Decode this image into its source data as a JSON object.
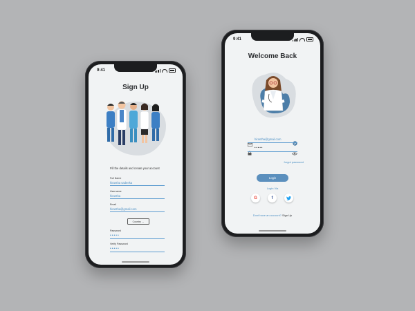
{
  "signup": {
    "time": "9:41",
    "title": "Sign Up",
    "subtitle": "Fill the details and create your account",
    "full_name_label": "Full Name",
    "full_name_value": "hirantha sadeeka",
    "username_label": "Username",
    "username_value": "hirantha",
    "email_label": "Email",
    "email_value": "hirantha@gmail.com",
    "country_label": "Country",
    "password_label": "Password",
    "password_value": "•••••",
    "verify_label": "Verify Password",
    "verify_value": "•••••"
  },
  "login": {
    "time": "9:41",
    "title": "Welcome Back",
    "email_value": "hirantha@gmail.com",
    "password_value": "•••••",
    "forgot": "forgot password",
    "login_button": "Login",
    "login_via": "Login Via",
    "google": "G",
    "facebook": "f",
    "signup_question": "Dont have an account?",
    "signup_link": "Sign Up"
  },
  "colors": {
    "accent": "#5b8fbd",
    "link": "#4b8fc4",
    "background": "#b3b4b6",
    "screen": "#f1f3f4"
  },
  "icons": [
    "envelope-icon",
    "lock-icon",
    "check-circle-icon",
    "eye-icon",
    "google-icon",
    "facebook-icon",
    "twitter-icon"
  ]
}
